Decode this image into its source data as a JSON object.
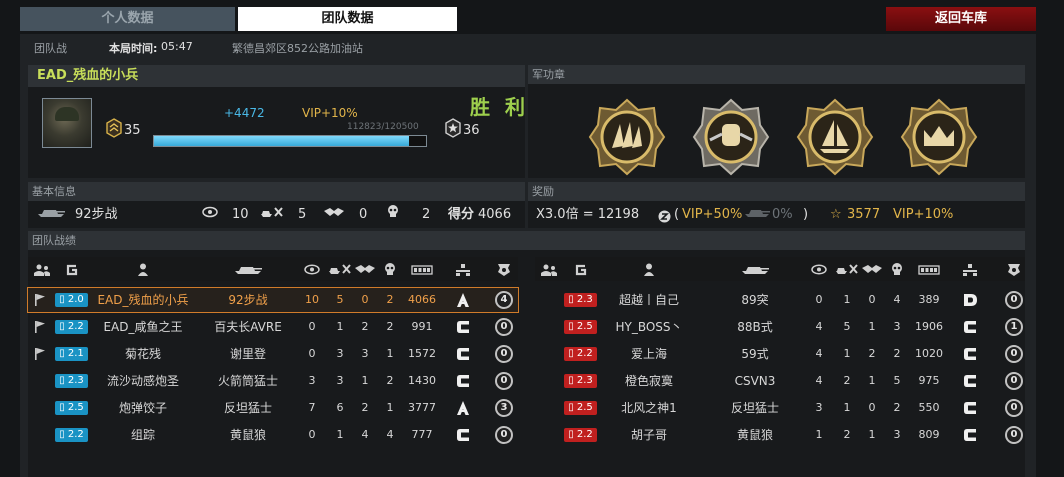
{
  "tabs": {
    "personal": "个人数据",
    "team": "团队数据",
    "back": "返回车库"
  },
  "info": {
    "mode": "团队战",
    "time_label": "本局时间:",
    "time": "05:47",
    "map": "繁德昌郊区852公路加油站"
  },
  "player": {
    "name": "EAD_残血的小兵",
    "rank_current": "35",
    "rank_next": "36",
    "xp_gain": "+4472",
    "vip_bonus": "VIP+10%",
    "result": "胜 利",
    "xp_text": "112823/120500",
    "xp_progress": 0.936
  },
  "sections": {
    "medals": "军功章",
    "basic": "基本信息",
    "rewards": "奖励",
    "team_stats": "团队战绩"
  },
  "medals": [
    {
      "icon": "wing-medal-icon"
    },
    {
      "icon": "fist-medal-icon"
    },
    {
      "icon": "ship-medal-icon"
    },
    {
      "icon": "crown-medal-icon"
    }
  ],
  "basic": {
    "vehicle": "92步战",
    "spot": "10",
    "dmg": "5",
    "assist": "0",
    "kill": "2",
    "score_label": "得分",
    "score": "4066"
  },
  "reward": {
    "mult": "X3.0倍 = 12198",
    "vip1": "VIP+50%",
    "mid": "0%",
    "close": ")",
    "open": "(",
    "star": "3577",
    "vip2": "VIP+10%"
  },
  "left_team": [
    {
      "flag": true,
      "skill": "2.0",
      "name": "EAD_残血的小兵",
      "vehicle": "92步战",
      "spot": "10",
      "dmg": "5",
      "assist": "0",
      "kill": "2",
      "score": "4066",
      "grade": "A",
      "award": "4",
      "self": true
    },
    {
      "flag": true,
      "skill": "2.2",
      "name": "EAD_咸鱼之王",
      "vehicle": "百夫长AVRE",
      "spot": "0",
      "dmg": "1",
      "assist": "2",
      "kill": "2",
      "score": "991",
      "grade": "C",
      "award": "0"
    },
    {
      "flag": true,
      "skill": "2.1",
      "name": "菊花残",
      "vehicle": "谢里登",
      "spot": "0",
      "dmg": "3",
      "assist": "3",
      "kill": "1",
      "score": "1572",
      "grade": "C",
      "award": "0"
    },
    {
      "flag": false,
      "skill": "2.3",
      "name": "流沙动感炮圣",
      "vehicle": "火箭筒猛士",
      "spot": "3",
      "dmg": "3",
      "assist": "1",
      "kill": "2",
      "score": "1430",
      "grade": "C",
      "award": "0"
    },
    {
      "flag": false,
      "skill": "2.5",
      "name": "炮弹饺子",
      "vehicle": "反坦猛士",
      "spot": "7",
      "dmg": "6",
      "assist": "2",
      "kill": "1",
      "score": "3777",
      "grade": "A",
      "award": "3"
    },
    {
      "flag": false,
      "skill": "2.2",
      "name": "组踪",
      "vehicle": "黄鼠狼",
      "spot": "0",
      "dmg": "1",
      "assist": "4",
      "kill": "4",
      "score": "777",
      "grade": "C",
      "award": "0"
    }
  ],
  "right_team": [
    {
      "skill": "2.3",
      "name": "超越丨自己",
      "vehicle": "89突",
      "spot": "0",
      "dmg": "1",
      "assist": "0",
      "kill": "4",
      "score": "389",
      "grade": "D",
      "award": "0"
    },
    {
      "skill": "2.5",
      "name": "HY_BOSS丶",
      "vehicle": "88B式",
      "spot": "4",
      "dmg": "5",
      "assist": "1",
      "kill": "3",
      "score": "1906",
      "grade": "C",
      "award": "1"
    },
    {
      "skill": "2.2",
      "name": "爱上海",
      "vehicle": "59式",
      "spot": "4",
      "dmg": "1",
      "assist": "2",
      "kill": "2",
      "score": "1020",
      "grade": "C",
      "award": "0"
    },
    {
      "skill": "2.3",
      "name": "橙色寂寞",
      "vehicle": "CSVN3",
      "spot": "4",
      "dmg": "2",
      "assist": "1",
      "kill": "5",
      "score": "975",
      "grade": "C",
      "award": "0"
    },
    {
      "skill": "2.5",
      "name": "北风之神1",
      "vehicle": "反坦猛士",
      "spot": "3",
      "dmg": "1",
      "assist": "0",
      "kill": "2",
      "score": "550",
      "grade": "C",
      "award": "0"
    },
    {
      "skill": "2.2",
      "name": "胡子哥",
      "vehicle": "黄鼠狼",
      "spot": "1",
      "dmg": "2",
      "assist": "1",
      "kill": "3",
      "score": "809",
      "grade": "C",
      "award": "0"
    }
  ],
  "colors": {
    "accent_green": "#c8de5a",
    "victory": "#9ed04d",
    "xp_blue": "#49b8e6",
    "vip_gold": "#e2b54a",
    "back_red": "#8a0f11",
    "self_orange": "#f0a04a"
  }
}
